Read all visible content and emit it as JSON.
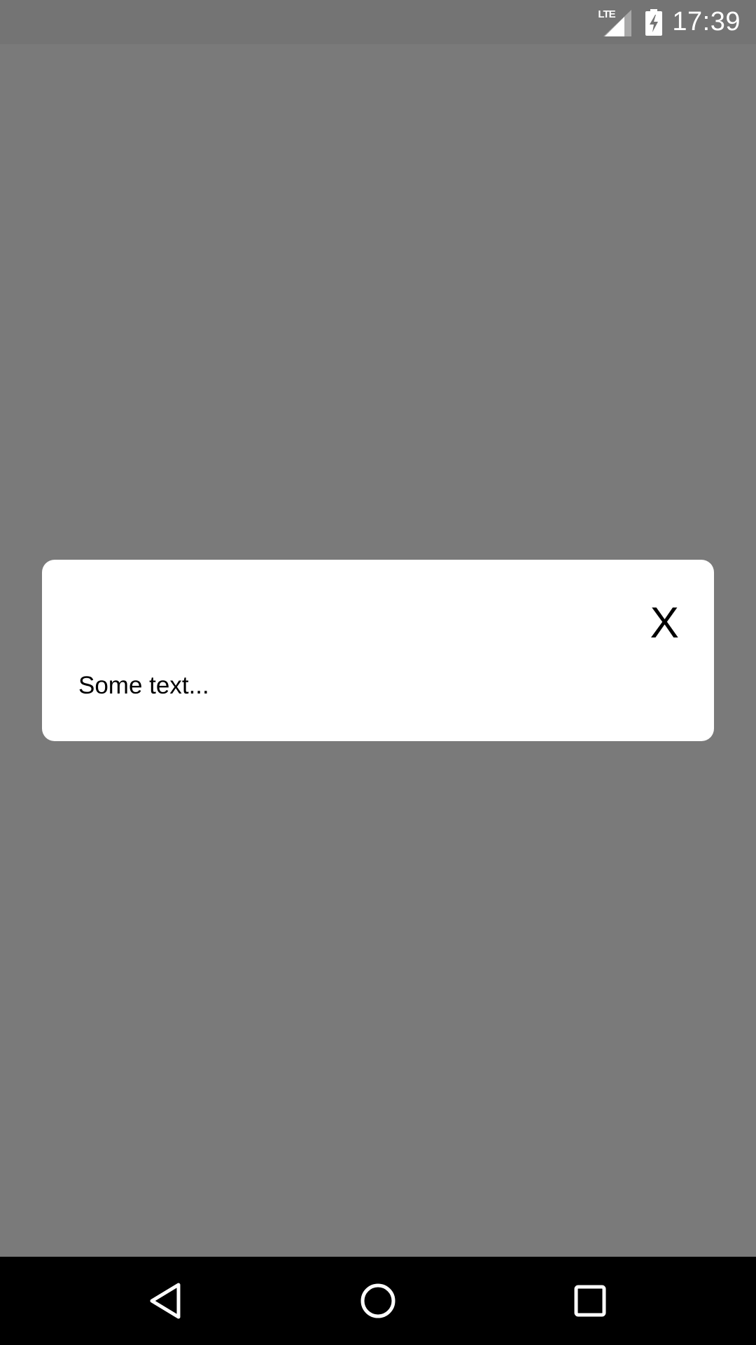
{
  "status_bar": {
    "network_label": "LTE",
    "time": "17:39",
    "icons": [
      "lte-signal-icon",
      "battery-charging-icon"
    ]
  },
  "dialog": {
    "close_label": "X",
    "body_text": "Some text..."
  },
  "nav_bar": {
    "icons": [
      "back-icon",
      "home-icon",
      "recents-icon"
    ]
  },
  "colors": {
    "scrim": "#7a7a7a",
    "status_bar": "#747474",
    "dialog_bg": "#ffffff",
    "nav_bar": "#000000"
  }
}
